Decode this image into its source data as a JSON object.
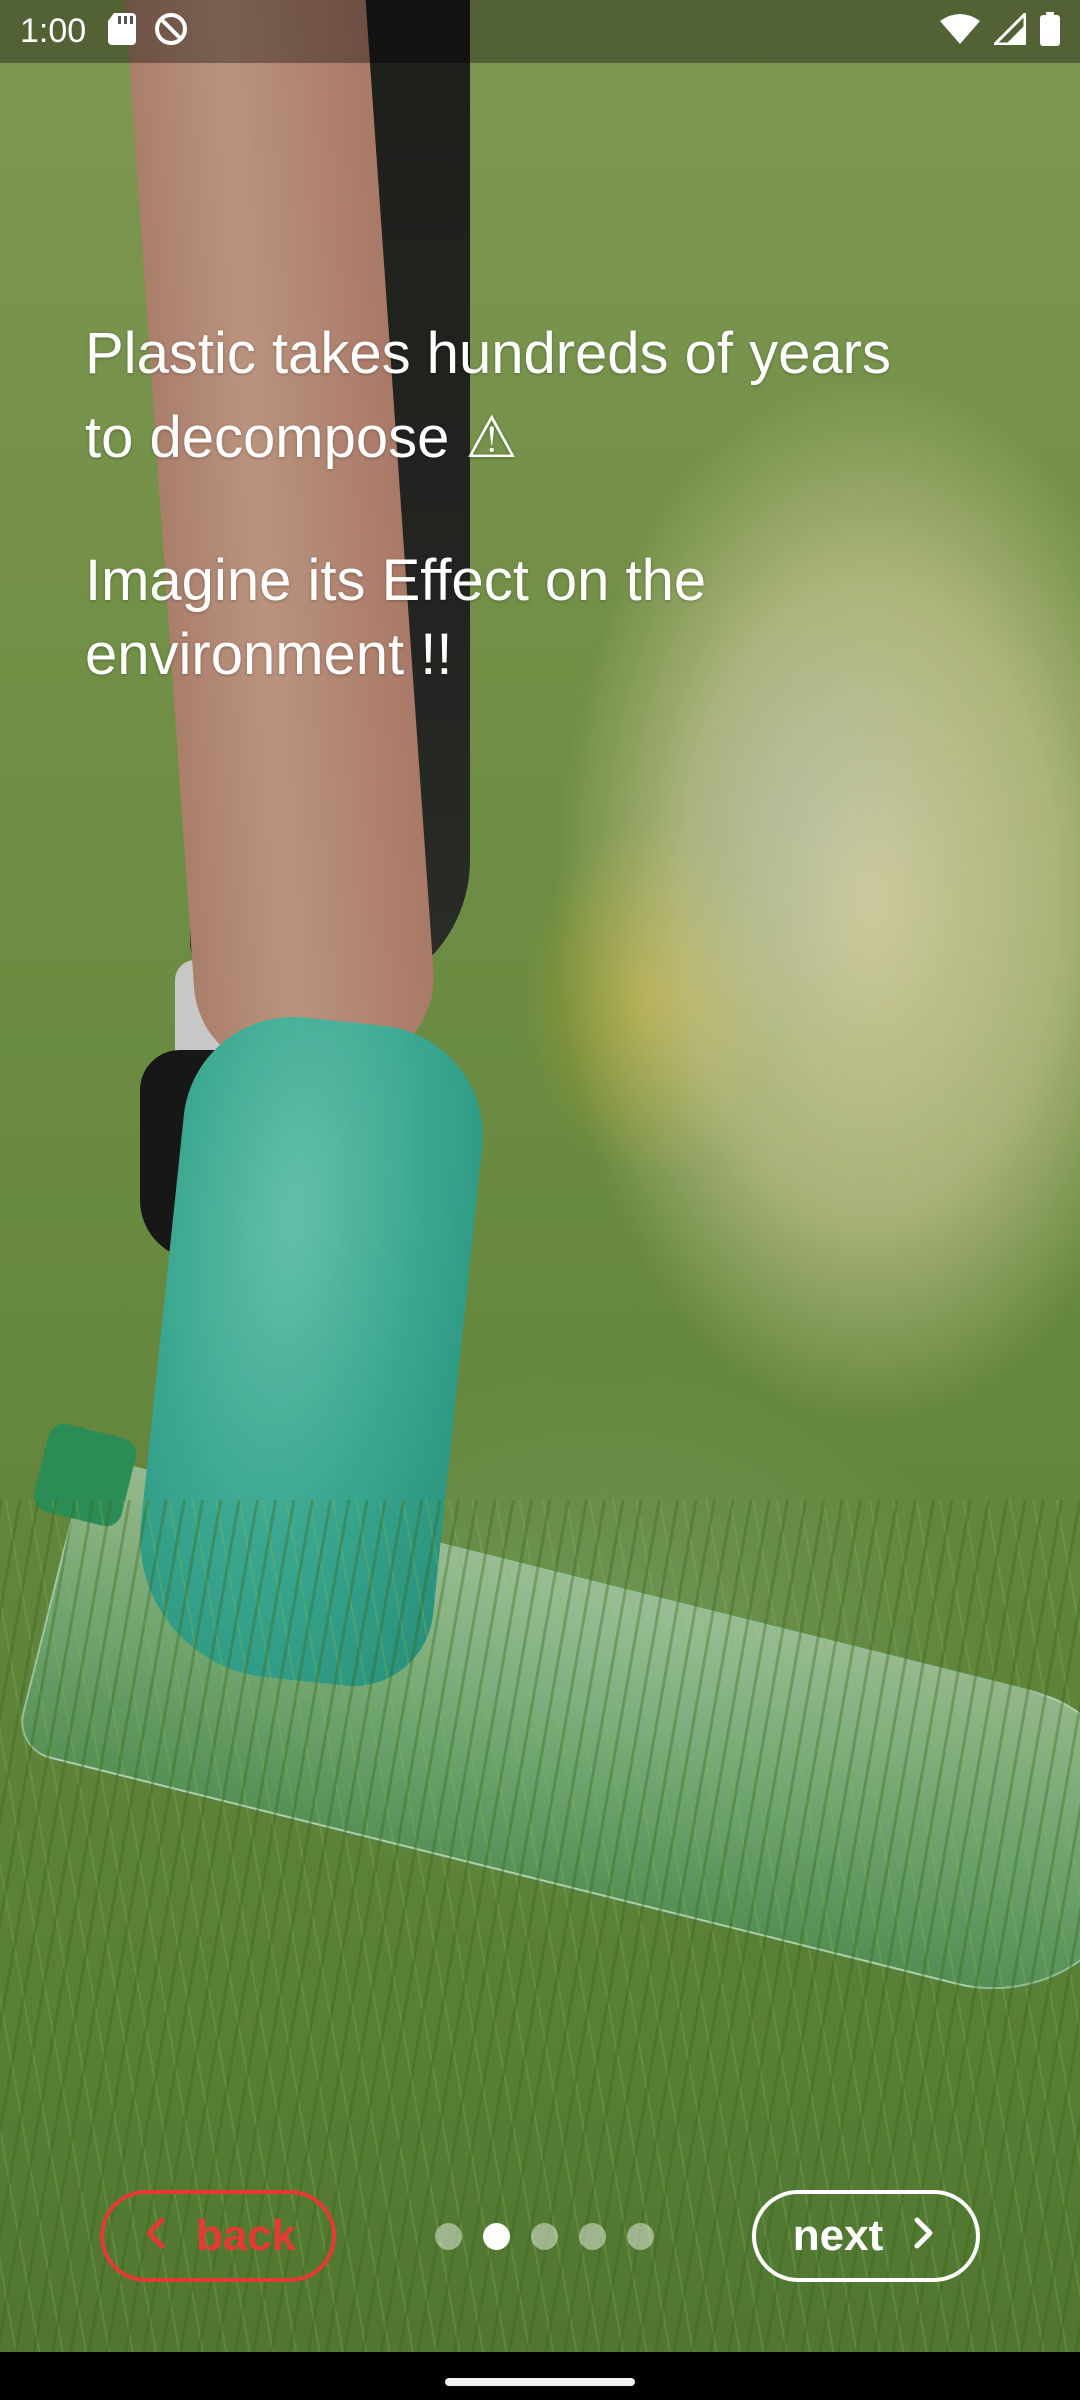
{
  "status_bar": {
    "time": "1:00",
    "left_icons": [
      "sd-card-icon",
      "do-not-disturb-icon"
    ],
    "right_icons": [
      "wifi-icon",
      "cellular-signal-icon",
      "battery-icon"
    ]
  },
  "message": {
    "line1": "Plastic takes hundreds of years\nto decompose ⚠",
    "line2": "Imagine its Effect on the\nenvironment !!"
  },
  "controls": {
    "back_label": "back",
    "next_label": "next",
    "page_count": 5,
    "current_page": 2
  },
  "colors": {
    "back_accent": "#e53935",
    "next_accent": "#ffffff",
    "text": "#ffffff"
  }
}
